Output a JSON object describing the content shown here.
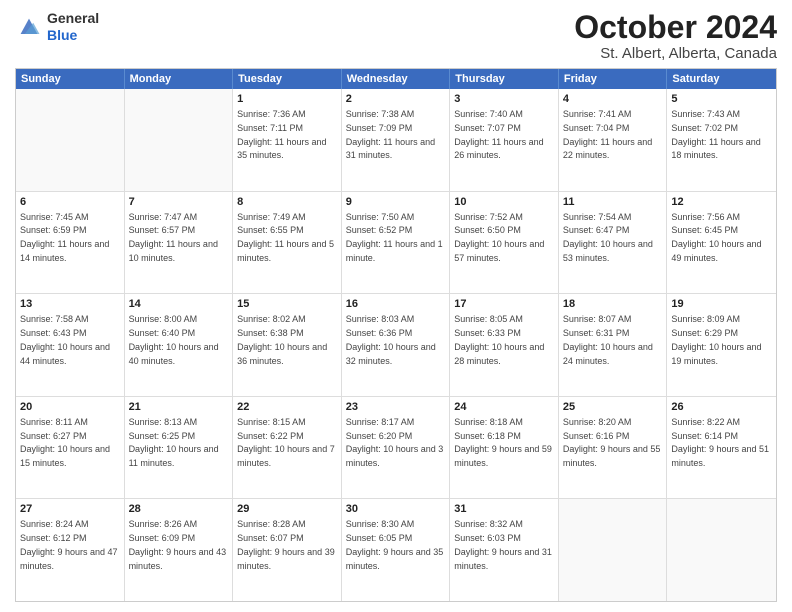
{
  "header": {
    "logo": {
      "line1": "General",
      "line2": "Blue"
    },
    "title": "October 2024",
    "subtitle": "St. Albert, Alberta, Canada"
  },
  "weekdays": [
    "Sunday",
    "Monday",
    "Tuesday",
    "Wednesday",
    "Thursday",
    "Friday",
    "Saturday"
  ],
  "weeks": [
    [
      {
        "day": "",
        "sunrise": "",
        "sunset": "",
        "daylight": "",
        "empty": true
      },
      {
        "day": "",
        "sunrise": "",
        "sunset": "",
        "daylight": "",
        "empty": true
      },
      {
        "day": "1",
        "sunrise": "Sunrise: 7:36 AM",
        "sunset": "Sunset: 7:11 PM",
        "daylight": "Daylight: 11 hours and 35 minutes.",
        "empty": false
      },
      {
        "day": "2",
        "sunrise": "Sunrise: 7:38 AM",
        "sunset": "Sunset: 7:09 PM",
        "daylight": "Daylight: 11 hours and 31 minutes.",
        "empty": false
      },
      {
        "day": "3",
        "sunrise": "Sunrise: 7:40 AM",
        "sunset": "Sunset: 7:07 PM",
        "daylight": "Daylight: 11 hours and 26 minutes.",
        "empty": false
      },
      {
        "day": "4",
        "sunrise": "Sunrise: 7:41 AM",
        "sunset": "Sunset: 7:04 PM",
        "daylight": "Daylight: 11 hours and 22 minutes.",
        "empty": false
      },
      {
        "day": "5",
        "sunrise": "Sunrise: 7:43 AM",
        "sunset": "Sunset: 7:02 PM",
        "daylight": "Daylight: 11 hours and 18 minutes.",
        "empty": false
      }
    ],
    [
      {
        "day": "6",
        "sunrise": "Sunrise: 7:45 AM",
        "sunset": "Sunset: 6:59 PM",
        "daylight": "Daylight: 11 hours and 14 minutes.",
        "empty": false
      },
      {
        "day": "7",
        "sunrise": "Sunrise: 7:47 AM",
        "sunset": "Sunset: 6:57 PM",
        "daylight": "Daylight: 11 hours and 10 minutes.",
        "empty": false
      },
      {
        "day": "8",
        "sunrise": "Sunrise: 7:49 AM",
        "sunset": "Sunset: 6:55 PM",
        "daylight": "Daylight: 11 hours and 5 minutes.",
        "empty": false
      },
      {
        "day": "9",
        "sunrise": "Sunrise: 7:50 AM",
        "sunset": "Sunset: 6:52 PM",
        "daylight": "Daylight: 11 hours and 1 minute.",
        "empty": false
      },
      {
        "day": "10",
        "sunrise": "Sunrise: 7:52 AM",
        "sunset": "Sunset: 6:50 PM",
        "daylight": "Daylight: 10 hours and 57 minutes.",
        "empty": false
      },
      {
        "day": "11",
        "sunrise": "Sunrise: 7:54 AM",
        "sunset": "Sunset: 6:47 PM",
        "daylight": "Daylight: 10 hours and 53 minutes.",
        "empty": false
      },
      {
        "day": "12",
        "sunrise": "Sunrise: 7:56 AM",
        "sunset": "Sunset: 6:45 PM",
        "daylight": "Daylight: 10 hours and 49 minutes.",
        "empty": false
      }
    ],
    [
      {
        "day": "13",
        "sunrise": "Sunrise: 7:58 AM",
        "sunset": "Sunset: 6:43 PM",
        "daylight": "Daylight: 10 hours and 44 minutes.",
        "empty": false
      },
      {
        "day": "14",
        "sunrise": "Sunrise: 8:00 AM",
        "sunset": "Sunset: 6:40 PM",
        "daylight": "Daylight: 10 hours and 40 minutes.",
        "empty": false
      },
      {
        "day": "15",
        "sunrise": "Sunrise: 8:02 AM",
        "sunset": "Sunset: 6:38 PM",
        "daylight": "Daylight: 10 hours and 36 minutes.",
        "empty": false
      },
      {
        "day": "16",
        "sunrise": "Sunrise: 8:03 AM",
        "sunset": "Sunset: 6:36 PM",
        "daylight": "Daylight: 10 hours and 32 minutes.",
        "empty": false
      },
      {
        "day": "17",
        "sunrise": "Sunrise: 8:05 AM",
        "sunset": "Sunset: 6:33 PM",
        "daylight": "Daylight: 10 hours and 28 minutes.",
        "empty": false
      },
      {
        "day": "18",
        "sunrise": "Sunrise: 8:07 AM",
        "sunset": "Sunset: 6:31 PM",
        "daylight": "Daylight: 10 hours and 24 minutes.",
        "empty": false
      },
      {
        "day": "19",
        "sunrise": "Sunrise: 8:09 AM",
        "sunset": "Sunset: 6:29 PM",
        "daylight": "Daylight: 10 hours and 19 minutes.",
        "empty": false
      }
    ],
    [
      {
        "day": "20",
        "sunrise": "Sunrise: 8:11 AM",
        "sunset": "Sunset: 6:27 PM",
        "daylight": "Daylight: 10 hours and 15 minutes.",
        "empty": false
      },
      {
        "day": "21",
        "sunrise": "Sunrise: 8:13 AM",
        "sunset": "Sunset: 6:25 PM",
        "daylight": "Daylight: 10 hours and 11 minutes.",
        "empty": false
      },
      {
        "day": "22",
        "sunrise": "Sunrise: 8:15 AM",
        "sunset": "Sunset: 6:22 PM",
        "daylight": "Daylight: 10 hours and 7 minutes.",
        "empty": false
      },
      {
        "day": "23",
        "sunrise": "Sunrise: 8:17 AM",
        "sunset": "Sunset: 6:20 PM",
        "daylight": "Daylight: 10 hours and 3 minutes.",
        "empty": false
      },
      {
        "day": "24",
        "sunrise": "Sunrise: 8:18 AM",
        "sunset": "Sunset: 6:18 PM",
        "daylight": "Daylight: 9 hours and 59 minutes.",
        "empty": false
      },
      {
        "day": "25",
        "sunrise": "Sunrise: 8:20 AM",
        "sunset": "Sunset: 6:16 PM",
        "daylight": "Daylight: 9 hours and 55 minutes.",
        "empty": false
      },
      {
        "day": "26",
        "sunrise": "Sunrise: 8:22 AM",
        "sunset": "Sunset: 6:14 PM",
        "daylight": "Daylight: 9 hours and 51 minutes.",
        "empty": false
      }
    ],
    [
      {
        "day": "27",
        "sunrise": "Sunrise: 8:24 AM",
        "sunset": "Sunset: 6:12 PM",
        "daylight": "Daylight: 9 hours and 47 minutes.",
        "empty": false
      },
      {
        "day": "28",
        "sunrise": "Sunrise: 8:26 AM",
        "sunset": "Sunset: 6:09 PM",
        "daylight": "Daylight: 9 hours and 43 minutes.",
        "empty": false
      },
      {
        "day": "29",
        "sunrise": "Sunrise: 8:28 AM",
        "sunset": "Sunset: 6:07 PM",
        "daylight": "Daylight: 9 hours and 39 minutes.",
        "empty": false
      },
      {
        "day": "30",
        "sunrise": "Sunrise: 8:30 AM",
        "sunset": "Sunset: 6:05 PM",
        "daylight": "Daylight: 9 hours and 35 minutes.",
        "empty": false
      },
      {
        "day": "31",
        "sunrise": "Sunrise: 8:32 AM",
        "sunset": "Sunset: 6:03 PM",
        "daylight": "Daylight: 9 hours and 31 minutes.",
        "empty": false
      },
      {
        "day": "",
        "sunrise": "",
        "sunset": "",
        "daylight": "",
        "empty": true
      },
      {
        "day": "",
        "sunrise": "",
        "sunset": "",
        "daylight": "",
        "empty": true
      }
    ]
  ]
}
